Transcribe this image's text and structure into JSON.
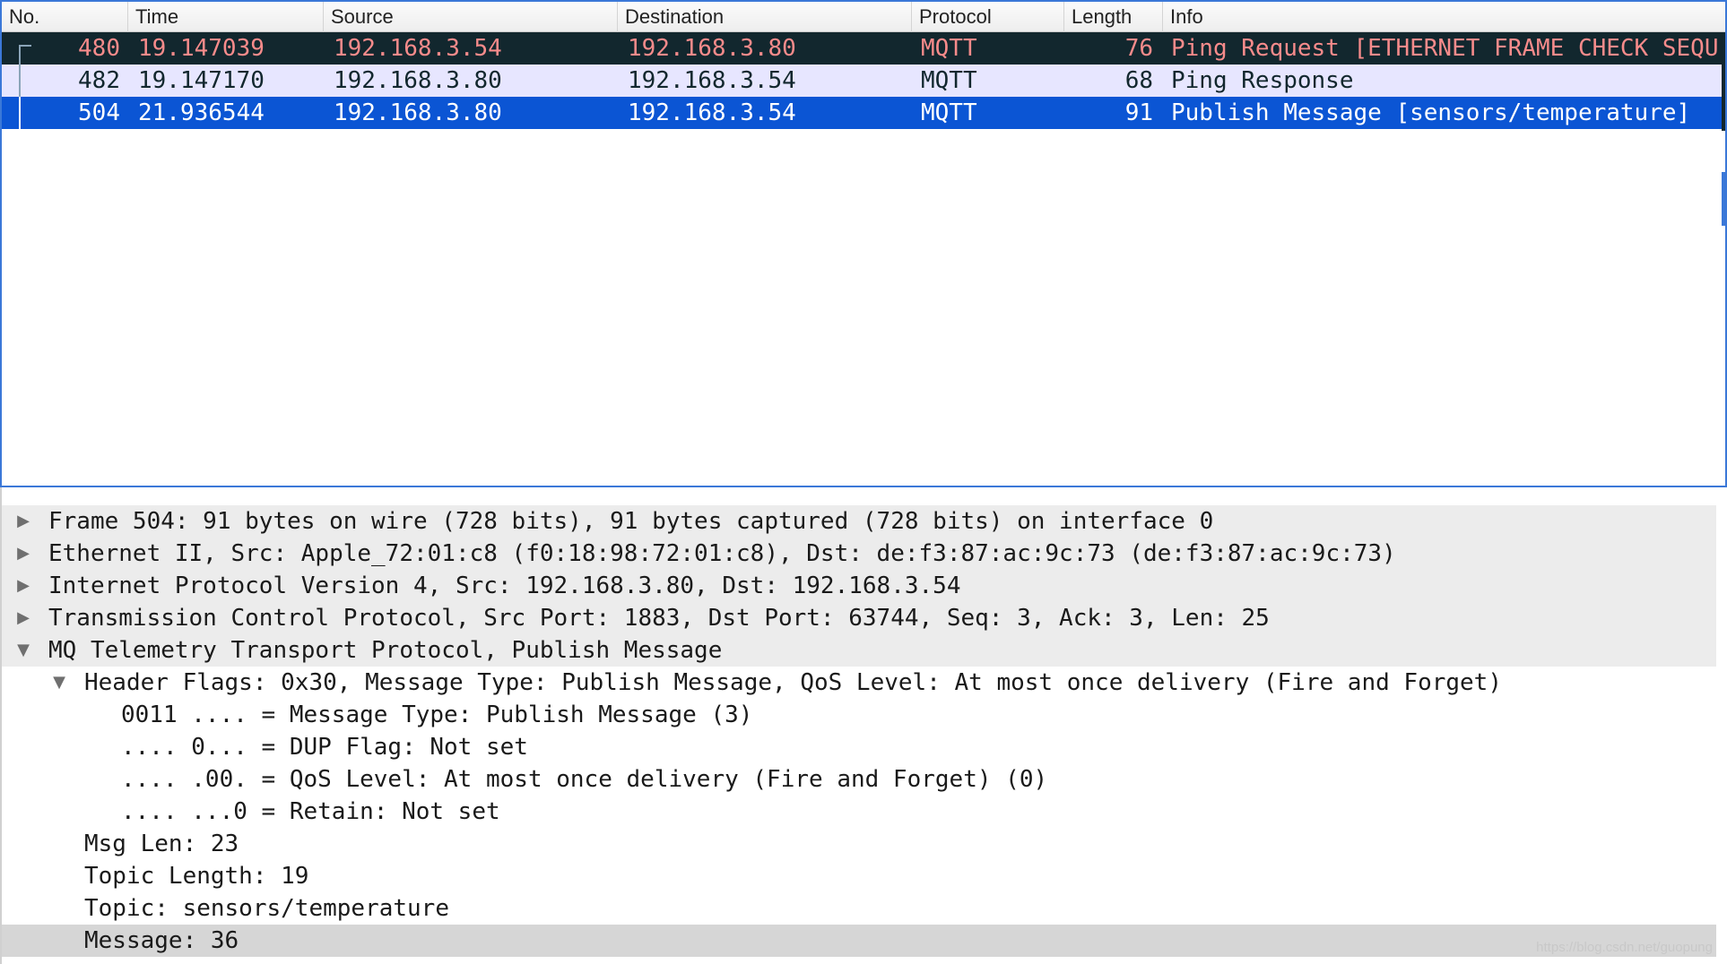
{
  "packet_list": {
    "columns": [
      "No.",
      "Time",
      "Source",
      "Destination",
      "Protocol",
      "Length",
      "Info"
    ],
    "rows": [
      {
        "no": "480",
        "time": "19.147039",
        "source": "192.168.3.54",
        "destination": "192.168.3.80",
        "protocol": "MQTT",
        "length": "76",
        "info": "Ping Request [ETHERNET FRAME CHECK SEQU"
      },
      {
        "no": "482",
        "time": "19.147170",
        "source": "192.168.3.80",
        "destination": "192.168.3.54",
        "protocol": "MQTT",
        "length": "68",
        "info": "Ping Response"
      },
      {
        "no": "504",
        "time": "21.936544",
        "source": "192.168.3.80",
        "destination": "192.168.3.54",
        "protocol": "MQTT",
        "length": "91",
        "info": "Publish Message [sensors/temperature]"
      }
    ],
    "selected_row": "504"
  },
  "details": {
    "rows": [
      {
        "text": "Frame 504: 91 bytes on wire (728 bits), 91 bytes captured (728 bits) on interface 0",
        "toggle": "▶",
        "level": 0,
        "shaded": true
      },
      {
        "text": "Ethernet II, Src: Apple_72:01:c8 (f0:18:98:72:01:c8), Dst: de:f3:87:ac:9c:73 (de:f3:87:ac:9c:73)",
        "toggle": "▶",
        "level": 0,
        "shaded": true
      },
      {
        "text": "Internet Protocol Version 4, Src: 192.168.3.80, Dst: 192.168.3.54",
        "toggle": "▶",
        "level": 0,
        "shaded": true
      },
      {
        "text": "Transmission Control Protocol, Src Port: 1883, Dst Port: 63744, Seq: 3, Ack: 3, Len: 25",
        "toggle": "▶",
        "level": 0,
        "shaded": true
      },
      {
        "text": "MQ Telemetry Transport Protocol, Publish Message",
        "toggle": "▼",
        "level": 0,
        "shaded": true
      },
      {
        "text": "Header Flags: 0x30, Message Type: Publish Message, QoS Level: At most once delivery (Fire and Forget)",
        "toggle": "▼",
        "level": 1,
        "shaded": false
      },
      {
        "text": "0011 .... = Message Type: Publish Message (3)",
        "toggle": "",
        "level": 2,
        "shaded": false
      },
      {
        "text": ".... 0... = DUP Flag: Not set",
        "toggle": "",
        "level": 2,
        "shaded": false
      },
      {
        "text": ".... .00. = QoS Level: At most once delivery (Fire and Forget) (0)",
        "toggle": "",
        "level": 2,
        "shaded": false
      },
      {
        "text": ".... ...0 = Retain: Not set",
        "toggle": "",
        "level": 2,
        "shaded": false
      },
      {
        "text": "Msg Len: 23",
        "toggle": "",
        "level": 1,
        "shaded": false
      },
      {
        "text": "Topic Length: 19",
        "toggle": "",
        "level": 1,
        "shaded": false
      },
      {
        "text": "Topic: sensors/temperature",
        "toggle": "",
        "level": 1,
        "shaded": false
      },
      {
        "text": "Message: 36",
        "toggle": "",
        "level": 1,
        "shaded": false,
        "selected": true
      }
    ]
  },
  "watermark": "https://blog.csdn.net/guopung",
  "colors": {
    "bad_packet_bg": "#12272e",
    "bad_packet_fg": "#f78b8b",
    "normal_row_bg": "#e7e6ff",
    "selected_row_bg": "#0b55d4",
    "accent": "#3b78d8"
  }
}
